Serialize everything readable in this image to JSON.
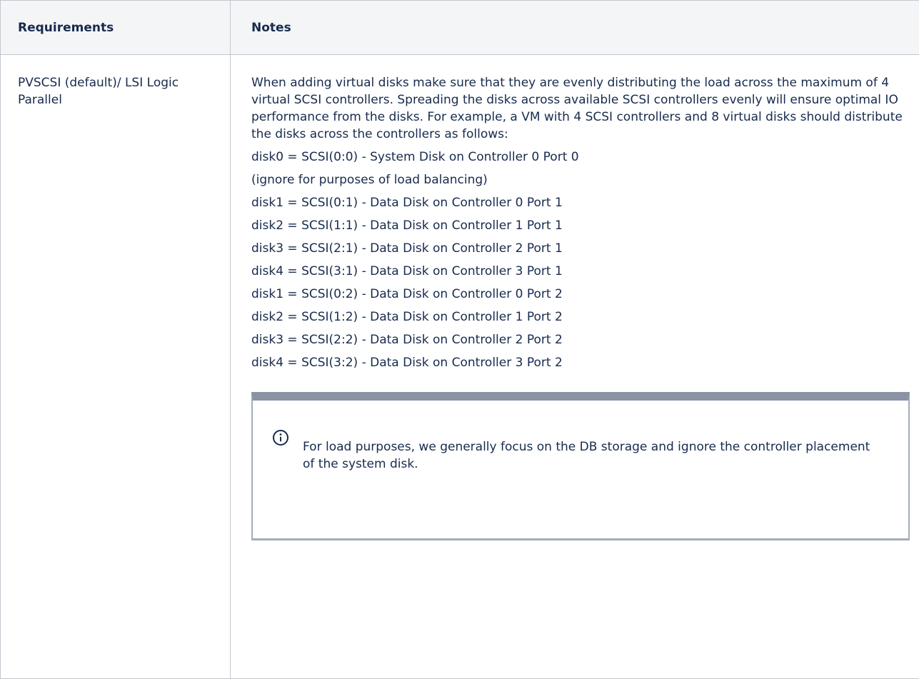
{
  "table": {
    "headers": {
      "requirements": "Requirements",
      "notes": "Notes"
    },
    "row": {
      "requirement": "PVSCSI (default)/ LSI Logic Parallel",
      "intro": "When adding virtual disks make sure that they are evenly distributing the load across the maximum of 4 virtual SCSI controllers. Spreading the disks across available SCSI controllers evenly will ensure optimal IO performance from the disks. For example, a VM with 4 SCSI controllers and 8 virtual disks should distribute the disks across the controllers as follows:",
      "disk_lines": [
        "disk0 = SCSI(0:0) - System Disk on Controller 0 Port 0",
        "(ignore for purposes of load balancing)",
        "disk1 = SCSI(0:1) - Data Disk on Controller 0 Port 1",
        "disk2 = SCSI(1:1) - Data Disk on Controller 1 Port 1",
        "disk3 = SCSI(2:1) - Data Disk on Controller 2 Port 1",
        "disk4 = SCSI(3:1) - Data Disk on Controller 3 Port 1",
        "disk1 = SCSI(0:2) - Data Disk on Controller 0 Port 2",
        "disk2 = SCSI(1:2) - Data Disk on Controller 1 Port 2",
        "disk3 = SCSI(2:2) - Data Disk on Controller 2 Port 2",
        "disk4 = SCSI(3:2) - Data Disk on Controller 3 Port 2"
      ],
      "note": {
        "icon": "info-icon",
        "text": "For load purposes, we generally focus on the DB storage and ignore the controller placement of the system disk."
      }
    }
  },
  "colors": {
    "header_bg": "#f4f5f7",
    "border": "#c1c7d0",
    "text": "#172b4d",
    "note_bar": "#8993a4"
  }
}
